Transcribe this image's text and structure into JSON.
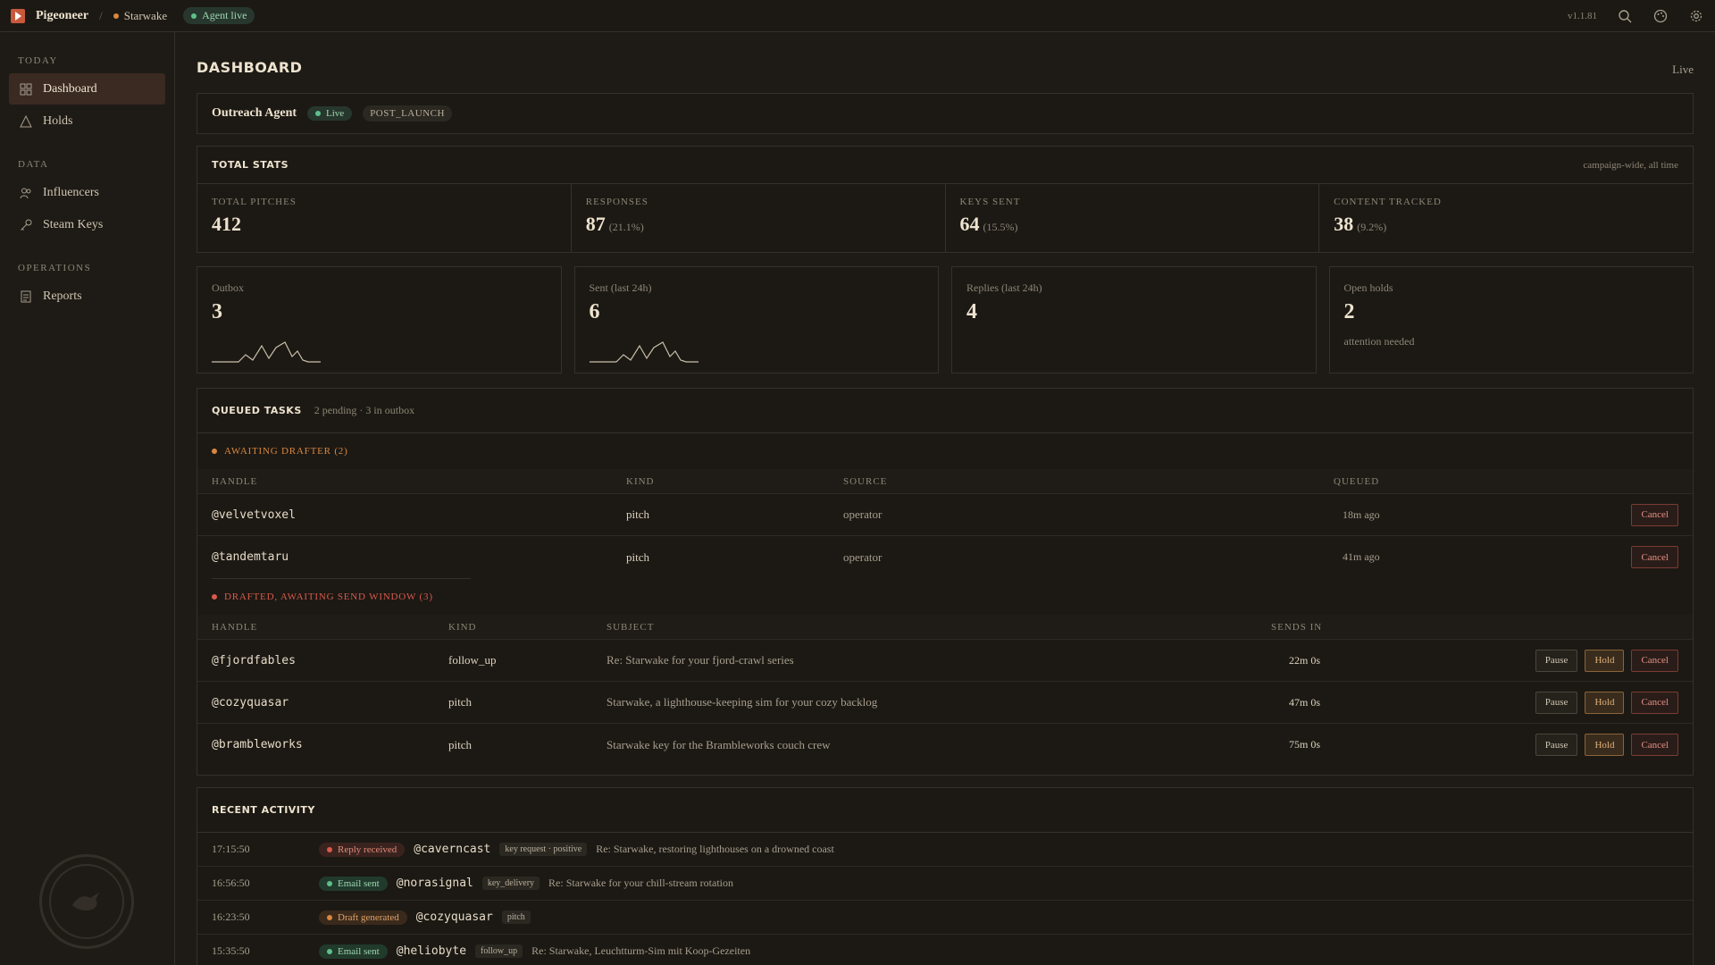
{
  "topbar": {
    "app_name": "Pigeoneer",
    "separator": "/",
    "project": "Starwake",
    "agent_status": "Agent live",
    "version": "v1.1.81",
    "icons": [
      "search-icon",
      "palette-icon",
      "gear-icon"
    ]
  },
  "sidebar": {
    "sections": [
      {
        "title": "TODAY",
        "items": [
          {
            "label": "Dashboard",
            "icon": "grid-icon",
            "active": true
          },
          {
            "label": "Holds",
            "icon": "warning-icon"
          }
        ]
      },
      {
        "title": "DATA",
        "items": [
          {
            "label": "Influencers",
            "icon": "users-icon"
          },
          {
            "label": "Steam Keys",
            "icon": "key-icon"
          }
        ]
      },
      {
        "title": "OPERATIONS",
        "items": [
          {
            "label": "Reports",
            "icon": "document-icon"
          }
        ]
      }
    ]
  },
  "page": {
    "title": "DASHBOARD",
    "live_link": "Live"
  },
  "agent": {
    "name": "Outreach Agent",
    "status": "Live",
    "phase": "POST_LAUNCH"
  },
  "total_stats": {
    "title": "TOTAL STATS",
    "subtitle": "campaign-wide, all time",
    "cells": [
      {
        "label": "TOTAL PITCHES",
        "value": "412",
        "pct": ""
      },
      {
        "label": "RESPONSES",
        "value": "87",
        "pct": "(21.1%)"
      },
      {
        "label": "KEYS SENT",
        "value": "64",
        "pct": "(15.5%)"
      },
      {
        "label": "CONTENT TRACKED",
        "value": "38",
        "pct": "(9.2%)"
      }
    ]
  },
  "cards": [
    {
      "label": "Outbox",
      "value": "3",
      "note": "",
      "sparkline": true
    },
    {
      "label": "Sent (last 24h)",
      "value": "6",
      "note": "",
      "sparkline": true
    },
    {
      "label": "Replies (last 24h)",
      "value": "4",
      "note": "",
      "sparkline": false
    },
    {
      "label": "Open holds",
      "value": "2",
      "note": "attention needed",
      "sparkline": false
    }
  ],
  "queue": {
    "title": "QUEUED TASKS",
    "subtitle": "2 pending · 3 in outbox",
    "drafter_group": {
      "label": "AWAITING DRAFTER (2)",
      "headers": [
        "HANDLE",
        "KIND",
        "SOURCE",
        "QUEUED"
      ],
      "rows": [
        {
          "handle": "@velvetvoxel",
          "kind": "pitch",
          "source": "operator",
          "queued": "18m ago",
          "cancel": "Cancel"
        },
        {
          "handle": "@tandemtaru",
          "kind": "pitch",
          "source": "operator",
          "queued": "41m ago",
          "cancel": "Cancel"
        }
      ]
    },
    "send_group": {
      "label": "DRAFTED, AWAITING SEND WINDOW (3)",
      "headers": [
        "HANDLE",
        "KIND",
        "SUBJECT",
        "SENDS IN"
      ],
      "rows": [
        {
          "handle": "@fjordfables",
          "kind": "follow_up",
          "subject": "Re: Starwake for your fjord-crawl series",
          "sends_in": "22m 0s",
          "pause": "Pause",
          "hold": "Hold",
          "cancel": "Cancel"
        },
        {
          "handle": "@cozyquasar",
          "kind": "pitch",
          "subject": "Starwake, a lighthouse-keeping sim for your cozy backlog",
          "sends_in": "47m 0s",
          "pause": "Pause",
          "hold": "Hold",
          "cancel": "Cancel"
        },
        {
          "handle": "@brambleworks",
          "kind": "pitch",
          "subject": "Starwake key for the Brambleworks couch crew",
          "sends_in": "75m 0s",
          "pause": "Pause",
          "hold": "Hold",
          "cancel": "Cancel"
        }
      ]
    }
  },
  "activity": {
    "title": "RECENT ACTIVITY",
    "rows": [
      {
        "time": "17:15:50",
        "event": "Reply received",
        "kind": "reply",
        "handle": "@caverncast",
        "tag": "key request · positive",
        "subject": "Re: Starwake, restoring lighthouses on a drowned coast"
      },
      {
        "time": "16:56:50",
        "event": "Email sent",
        "kind": "sent",
        "handle": "@norasignal",
        "tag": "key_delivery",
        "subject": "Re: Starwake for your chill-stream rotation"
      },
      {
        "time": "16:23:50",
        "event": "Draft generated",
        "kind": "draft",
        "handle": "@cozyquasar",
        "tag": "pitch",
        "subject": ""
      },
      {
        "time": "15:35:50",
        "event": "Email sent",
        "kind": "sent",
        "handle": "@heliobyte",
        "tag": "follow_up",
        "subject": "Re: Starwake, Leuchtturm-Sim mit Koop-Gezeiten"
      }
    ]
  },
  "colors": {
    "accent": "#c8593c",
    "live_green": "#5fbf8a",
    "hold_amber": "#e0b17a",
    "cancel_red": "#e58f84"
  }
}
